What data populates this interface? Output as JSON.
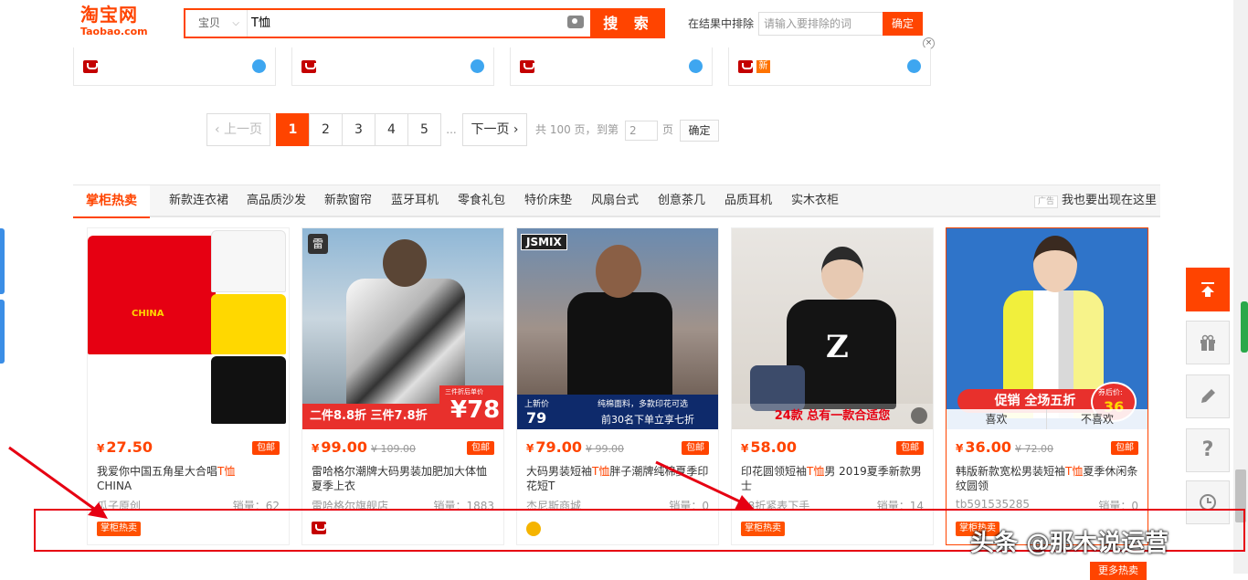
{
  "header": {
    "logo_cn": "淘宝网",
    "logo_en": "Taobao.com",
    "search_category": "宝贝",
    "search_value": "T恤",
    "search_button": "搜 索",
    "exclude_label": "在结果中排除",
    "exclude_placeholder": "请输入要排除的词",
    "exclude_button": "确定",
    "close_glyph": "×"
  },
  "prev_row": {
    "new_badge": "新"
  },
  "pagination": {
    "prev": "上一页",
    "pages": [
      "1",
      "2",
      "3",
      "4",
      "5"
    ],
    "current": "1",
    "dots": "...",
    "next": "下一页",
    "total": "共 100 页，",
    "goto": "到第",
    "goto_value": "2",
    "page_unit": "页",
    "confirm": "确定"
  },
  "section": {
    "title": "掌柜热卖",
    "categories": [
      "新款连衣裙",
      "高品质沙发",
      "新款窗帘",
      "蓝牙耳机",
      "零食礼包",
      "特价床垫",
      "风扇台式",
      "创意茶几",
      "品质耳机",
      "实木衣柜"
    ],
    "ad_tag": "广告",
    "ad_link": "我也要出现在这里"
  },
  "products": [
    {
      "price": "27.50",
      "orig": "",
      "post": "包邮",
      "title_pre": "我爱你中国五角星大合唱",
      "title_kw": "T恤",
      "title_post": "CHINA",
      "store": "瓜子原创",
      "sold": "销量：62",
      "tag": "掌柜热卖",
      "img_text": "CHINA"
    },
    {
      "price": "99.00",
      "orig": "¥ 109.00",
      "post": "包邮",
      "title_pre": "雷哈格尔潮牌大码男装加肥加大体恤夏季上衣",
      "title_kw": "",
      "title_post": "",
      "store": "雷哈格尔旗舰店",
      "sold": "销量：1883",
      "tag": "",
      "img_band": "二件8.8折  三件7.8折",
      "img_price": "¥78",
      "img_small": "三件折后单价",
      "img_logo": "雷"
    },
    {
      "price": "79.00",
      "orig": "¥ 99.00",
      "post": "包邮",
      "title_pre": "大码男装短袖",
      "title_kw": "T恤",
      "title_post": "胖子潮牌纯棉夏季印花短T",
      "store": "杰尼斯商城",
      "sold": "销量：0",
      "tag": "",
      "img_logo": "JSMIX",
      "img_band1": "上新价",
      "img_band2": "79",
      "img_band3": "纯棉面料，多款印花可选",
      "img_band4": "前30名下单立享七折"
    },
    {
      "price": "58.00",
      "orig": "",
      "post": "包邮",
      "title_pre": "印花圆领短袖",
      "title_kw": "T恤",
      "title_post": "男 2019夏季新款男士",
      "store": "08折紧表下手",
      "sold": "销量：14",
      "tag": "掌柜热卖",
      "img_band": "24款 总有一款合适您",
      "img_letter": "Z"
    },
    {
      "price": "36.00",
      "orig": "¥ 72.00",
      "post": "包邮",
      "title_pre": "韩版新款宽松男装短袖",
      "title_kw": "T恤",
      "title_post": "夏季休闲条纹圆领",
      "store": "tb591535285",
      "sold": "销量：0",
      "tag": "掌柜热卖",
      "img_band": "促销 全场五折",
      "img_badge": "券后价:",
      "img_badge_num": "36",
      "like": "喜欢",
      "dislike": "不喜欢"
    }
  ],
  "currency": "¥",
  "watermark": "头条 @那木说运营",
  "more_button": "更多热卖",
  "colors": {
    "accent": "#ff4400",
    "annotation": "#e60012"
  },
  "icons": [
    "camera-icon",
    "back-to-top-icon",
    "gift-icon",
    "edit-icon",
    "help-icon",
    "clock-icon",
    "wangwang-icon",
    "shop-icon",
    "crown-icon"
  ],
  "toolbar": {
    "help_glyph": "?"
  }
}
